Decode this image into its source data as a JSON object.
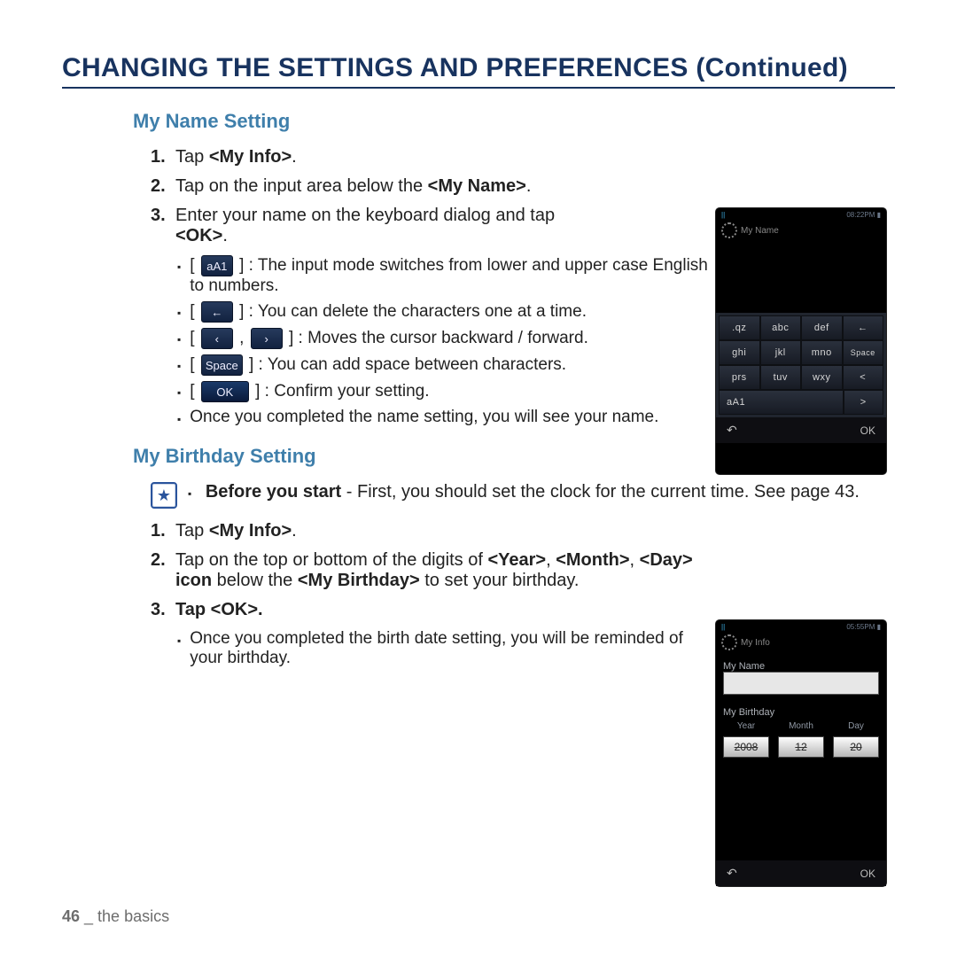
{
  "title": "CHANGING THE SETTINGS AND PREFERENCES (Continued)",
  "sec1": {
    "title": "My Name Setting",
    "s1_num": "1.",
    "s1_a": "Tap ",
    "s1_b": "<My Info>",
    "s1_c": ".",
    "s2_num": "2.",
    "s2_a": "Tap on the input area below the ",
    "s2_b": "<My Name>",
    "s2_c": ".",
    "s3_num": "3.",
    "s3_a": "Enter your name on the keyboard dialog and tap",
    "s3_b": "<OK>",
    "s3_c": ".",
    "b1_key": "aA1",
    "b1_txt": " : The input mode switches from lower and upper case English to numbers.",
    "b2_key": "←",
    "b2_txt": " : You can delete the characters one at a time.",
    "b3_key1": "‹",
    "b3_key2": "›",
    "b3_txt": " : Moves the cursor backward / forward.",
    "b4_key": "Space",
    "b4_txt": " : You can add space between characters.",
    "b5_key": "OK",
    "b5_txt": " : Confirm your setting.",
    "b6_txt": "Once you completed the name setting, you will see your name."
  },
  "sec2": {
    "title": "My Birthday Setting",
    "note_a": "Before you start",
    "note_b": " - First, you should set the clock for the current time. See page 43.",
    "s1_num": "1.",
    "s1_a": "Tap ",
    "s1_b": "<My Info>",
    "s1_c": ".",
    "s2_num": "2.",
    "s2_a": "Tap on the top or bottom of the digits of ",
    "s2_b": "<Year>",
    "s2_c": ", ",
    "s2_d": "<Month>",
    "s2_e": ", ",
    "s2_f": "<Day> icon",
    "s2_g": " below the ",
    "s2_h": "<My Birthday>",
    "s2_i": " to set your birthday.",
    "s3_num": "3.",
    "s3_a": "Tap ",
    "s3_b": "<OK>",
    "s3_c": ".",
    "b1_txt": "Once you completed the birth date setting, you will be reminded of your birthday."
  },
  "footer": {
    "page": "46",
    "sep": " _ ",
    "chapter": "the basics"
  },
  "dev1": {
    "status_l": "||",
    "status_r": "08:22PM ▮",
    "hdr": "My Name",
    "keys": [
      [
        ".qz",
        "abc",
        "def",
        "←"
      ],
      [
        "ghi",
        "jkl",
        "mno",
        "Space"
      ],
      [
        "prs",
        "tuv",
        "wxy",
        "<"
      ],
      [
        "aA1",
        "",
        "",
        ">"
      ]
    ],
    "ok": "OK"
  },
  "dev2": {
    "status_l": "||",
    "status_r": "05:55PM ▮",
    "hdr": "My Info",
    "label_name": "My Name",
    "label_bday": "My Birthday",
    "cols": [
      "Year",
      "Month",
      "Day"
    ],
    "vals": [
      "2008",
      "12",
      "20"
    ],
    "ok": "OK"
  }
}
